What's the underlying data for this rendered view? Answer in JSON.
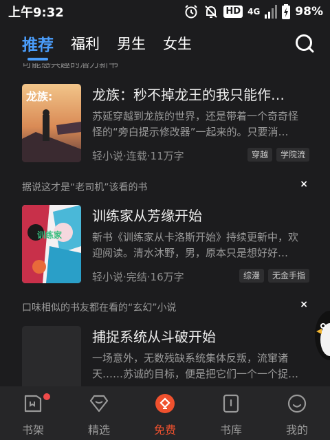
{
  "status_bar": {
    "time": "上午9:32",
    "hd": "HD",
    "network": "4G",
    "battery": "98%"
  },
  "tabs": [
    "推荐",
    "福利",
    "男生",
    "女生"
  ],
  "partial_section_header": "可能感兴趣的潜力新书",
  "books": [
    {
      "title": "龙族：秒不掉龙王的我只能作…",
      "description": "苏延穿越到龙族的世界，还是带着一个奇奇怪怪的“旁白提示修改器”一起来的。只要消…",
      "meta": "轻小说·连载·11万字",
      "tags": [
        "穿越",
        "学院流"
      ],
      "cover_text": "龙族:"
    },
    {
      "title": "训练家从芳缘开始",
      "description": "新书《训练家从卡洛斯开始》持续更新中，欢迎阅读。清水沐野，男，原本只是想好好…",
      "meta": "轻小说·完结·16万字",
      "tags": [
        "综漫",
        "无金手指"
      ],
      "cover_text": "训练家"
    },
    {
      "title": "捕捉系统从斗破开始",
      "description": "一场意外，无数残缺系统集体反叛，流窜诸天……苏诚的目标，便是把它们一个一个捉…",
      "meta": "",
      "tags": []
    }
  ],
  "section_headers": [
    {
      "text": "据说这才是“老司机”该看的书",
      "close": "×"
    },
    {
      "text": "口味相似的书友都在看的“玄幻”小说",
      "close": "×"
    }
  ],
  "bottom_nav": [
    {
      "label": "书架",
      "icon": "bookshelf-icon",
      "active": false,
      "badge": true
    },
    {
      "label": "精选",
      "icon": "selection-icon",
      "active": false,
      "badge": false
    },
    {
      "label": "免费",
      "icon": "free-icon",
      "active": true,
      "badge": false
    },
    {
      "label": "书库",
      "icon": "library-icon",
      "active": false,
      "badge": false
    },
    {
      "label": "我的",
      "icon": "profile-icon",
      "active": false,
      "badge": false
    }
  ],
  "colors": {
    "background": "#1c1c1e",
    "accent_blue": "#4a9dfb",
    "accent_orange": "#f0512e",
    "nav_background": "#262628"
  }
}
